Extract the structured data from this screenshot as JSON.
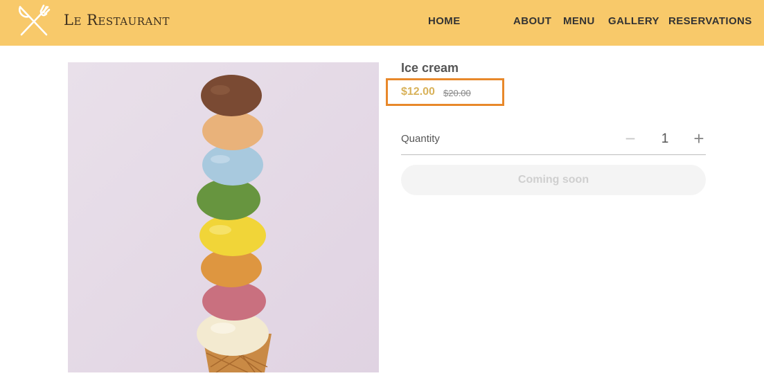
{
  "header": {
    "brand": "Le Restaurant",
    "logo_icon": "crossed-fork-knife-icon",
    "nav": [
      "HOME",
      "ABOUT",
      "MENU",
      "GALLERY",
      "RESERVATIONS"
    ]
  },
  "product": {
    "title": "Ice cream",
    "price_current": "$12.00",
    "price_original": "$20.00",
    "quantity_label": "Quantity",
    "quantity_value": "1",
    "minus_symbol": "−",
    "plus_symbol": "+",
    "button_label": "Coming soon",
    "image_subject": "ice-cream-cone-stack"
  },
  "colors": {
    "header_bg": "#f8c96a",
    "price_color": "#d8b25a",
    "highlight_border": "#e8882a"
  }
}
